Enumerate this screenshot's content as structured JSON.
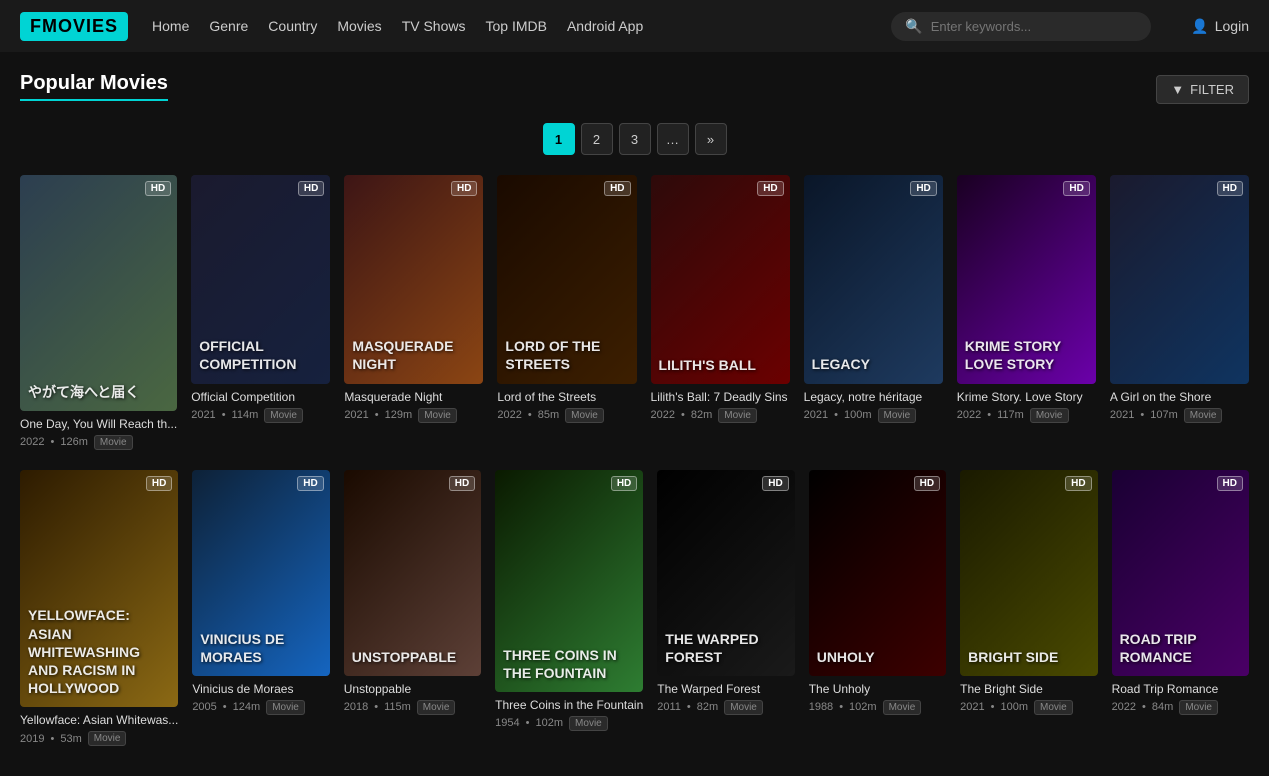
{
  "logo": "FMOVIES",
  "nav": {
    "links": [
      "Home",
      "Genre",
      "Country",
      "Movies",
      "TV Shows",
      "Top IMDB",
      "Android App"
    ],
    "search_placeholder": "Enter keywords...",
    "login_label": "Login"
  },
  "page": {
    "title": "Popular Movies",
    "filter_label": "FILTER"
  },
  "pagination": {
    "pages": [
      "1",
      "2",
      "3",
      "…",
      "»"
    ],
    "active": 0
  },
  "movies_row1": [
    {
      "title": "One Day, You Will Reach th...",
      "year": "2022",
      "duration": "126m",
      "type": "Movie",
      "hd": true,
      "poster_class": "poster-1",
      "poster_text": "やがて海へと届く"
    },
    {
      "title": "Official Competition",
      "year": "2021",
      "duration": "114m",
      "type": "Movie",
      "hd": true,
      "poster_class": "poster-2",
      "poster_text": "OFFICIAL COMPETITION"
    },
    {
      "title": "Masquerade Night",
      "year": "2021",
      "duration": "129m",
      "type": "Movie",
      "hd": true,
      "poster_class": "poster-3",
      "poster_text": "MASQUERADE NIGHT"
    },
    {
      "title": "Lord of the Streets",
      "year": "2022",
      "duration": "85m",
      "type": "Movie",
      "hd": true,
      "poster_class": "poster-4",
      "poster_text": "Lord of the STREETS"
    },
    {
      "title": "Lilith's Ball: 7 Deadly Sins",
      "year": "2022",
      "duration": "82m",
      "type": "Movie",
      "hd": true,
      "poster_class": "poster-5",
      "poster_text": "Lilith's BALL"
    },
    {
      "title": "Legacy, notre héritage",
      "year": "2021",
      "duration": "100m",
      "type": "Movie",
      "hd": true,
      "poster_class": "poster-6",
      "poster_text": "LEGACY"
    },
    {
      "title": "Krime Story. Love Story",
      "year": "2022",
      "duration": "117m",
      "type": "Movie",
      "hd": true,
      "poster_class": "poster-7",
      "poster_text": "Krime Story Love Story"
    },
    {
      "title": "A Girl on the Shore",
      "year": "2021",
      "duration": "107m",
      "type": "Movie",
      "hd": true,
      "poster_class": "poster-8",
      "poster_text": ""
    }
  ],
  "movies_row2": [
    {
      "title": "Yellowface: Asian Whitewas...",
      "year": "2019",
      "duration": "53m",
      "type": "Movie",
      "hd": true,
      "poster_class": "poster-9",
      "poster_text": "YELLOWFACE: Asian Whitewashing and Racism in Hollywood"
    },
    {
      "title": "Vinicius de Moraes",
      "year": "2005",
      "duration": "124m",
      "type": "Movie",
      "hd": true,
      "poster_class": "poster-10",
      "poster_text": "VINICIUS DE MORAES"
    },
    {
      "title": "Unstoppable",
      "year": "2018",
      "duration": "115m",
      "type": "Movie",
      "hd": true,
      "poster_class": "poster-11",
      "poster_text": "UNSTOPPABLE"
    },
    {
      "title": "Three Coins in the Fountain",
      "year": "1954",
      "duration": "102m",
      "type": "Movie",
      "hd": true,
      "poster_class": "poster-12",
      "poster_text": "Three Coins in the Fountain"
    },
    {
      "title": "The Warped Forest",
      "year": "2011",
      "duration": "82m",
      "type": "Movie",
      "hd": true,
      "poster_class": "poster-13",
      "poster_text": "THE WARPED FOREST"
    },
    {
      "title": "The Unholy",
      "year": "1988",
      "duration": "102m",
      "type": "Movie",
      "hd": true,
      "poster_class": "poster-15",
      "poster_text": "UNHOLY"
    },
    {
      "title": "The Bright Side",
      "year": "2021",
      "duration": "100m",
      "type": "Movie",
      "hd": true,
      "poster_class": "poster-14",
      "poster_text": "BRIGHT SIDE"
    },
    {
      "title": "Road Trip Romance",
      "year": "2022",
      "duration": "84m",
      "type": "Movie",
      "hd": true,
      "poster_class": "poster-16",
      "poster_text": "ROAD TRIP ROMANCE"
    }
  ]
}
